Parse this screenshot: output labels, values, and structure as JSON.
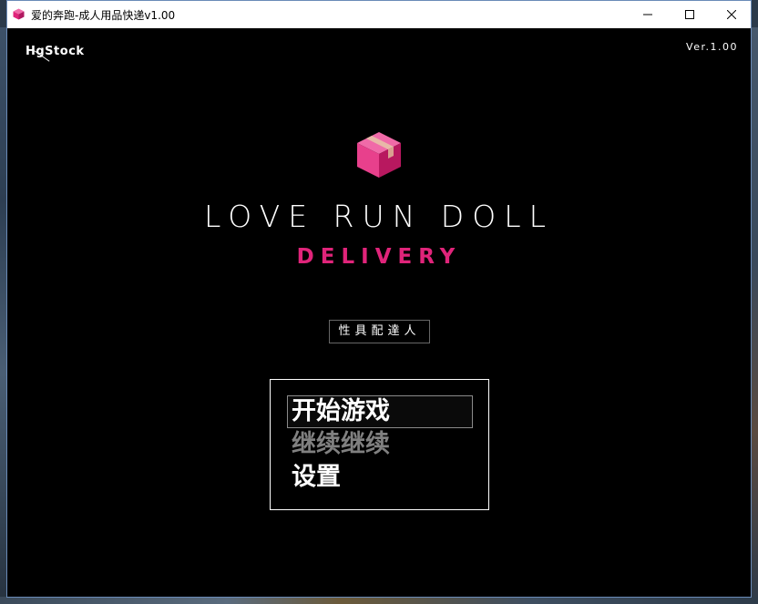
{
  "window": {
    "title": "爱的奔跑-成人用品快递v1.00",
    "controls": {
      "minimize": "—",
      "maximize": "☐",
      "close": "✕"
    }
  },
  "game": {
    "studio_logo": "HgStock",
    "version": "Ver.1.00",
    "title_main": "LOVE RUN DOLL",
    "title_sub": "DELIVERY",
    "tagline": "性具配達人",
    "menu": {
      "items": [
        {
          "label": "开始游戏",
          "state": "selected"
        },
        {
          "label": "继续继续",
          "state": "disabled"
        },
        {
          "label": "设置",
          "state": "enabled"
        }
      ]
    }
  },
  "colors": {
    "accent": "#e0247a",
    "background": "#000000",
    "box_icon": "#e8408c"
  },
  "icons": {
    "app": "pink-box-icon",
    "logo": "pink-box-icon"
  }
}
